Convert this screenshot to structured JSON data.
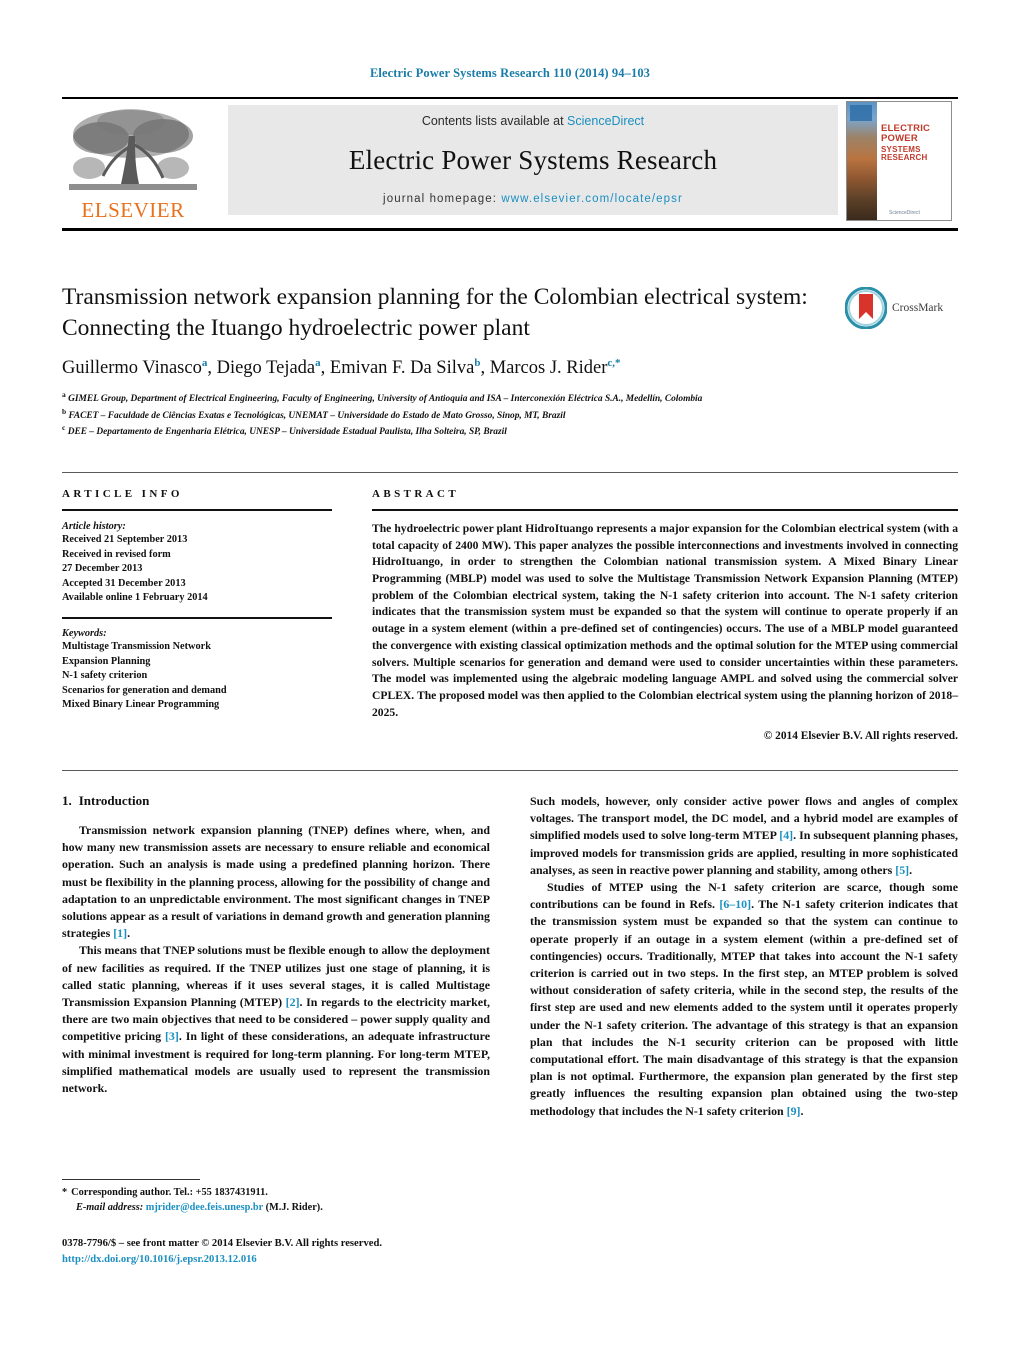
{
  "running_head": "Electric Power Systems Research 110 (2014) 94–103",
  "masthead": {
    "publisher_name": "ELSEVIER",
    "contents_prefix": "Contents lists available at ",
    "contents_link": "ScienceDirect",
    "journal_title": "Electric Power Systems Research",
    "homepage_prefix": "journal homepage: ",
    "homepage_url": "www.elsevier.com/locate/epsr",
    "cover": {
      "line1": "ELECTRIC POWER",
      "line2": "SYSTEMS RESEARCH",
      "foot": "ScienceDirect"
    }
  },
  "article": {
    "title": "Transmission network expansion planning for the Colombian electrical system: Connecting the Ituango hydroelectric power plant",
    "authors_plain": "Guillermo Vinasco a, Diego Tejada a, Emivan F. Da Silva b, Marcos J. Rider c,*",
    "authors": [
      {
        "name": "Guillermo Vinasco",
        "sup": "a"
      },
      {
        "name": "Diego Tejada",
        "sup": "a"
      },
      {
        "name": "Emivan F. Da Silva",
        "sup": "b"
      },
      {
        "name": "Marcos J. Rider",
        "sup": "c,*"
      }
    ],
    "affiliations": [
      {
        "marker": "a",
        "text": "GIMEL Group, Department of Electrical Engineering, Faculty of Engineering, University of Antioquia and ISA – Interconexión Eléctrica S.A., Medellín, Colombia"
      },
      {
        "marker": "b",
        "text": "FACET – Faculdade de Ciências Exatas e Tecnológicas, UNEMAT – Universidade do Estado de Mato Grosso, Sinop, MT, Brazil"
      },
      {
        "marker": "c",
        "text": "DEE – Departamento de Engenharia Elétrica, UNESP – Universidade Estadual Paulista, Ilha Solteira, SP, Brazil"
      }
    ],
    "crossmark_label": "CrossMark"
  },
  "info": {
    "label": "ARTICLE INFO",
    "history_title": "Article history:",
    "history_lines": [
      "Received 21 September 2013",
      "Received in revised form",
      "27 December 2013",
      "Accepted 31 December 2013",
      "Available online 1 February 2014"
    ],
    "keywords_title": "Keywords:",
    "keywords": [
      "Multistage Transmission Network",
      "Expansion Planning",
      "N-1 safety criterion",
      "Scenarios for generation and demand",
      "Mixed Binary Linear Programming"
    ]
  },
  "abstract": {
    "label": "ABSTRACT",
    "text": "The hydroelectric power plant HidroItuango represents a major expansion for the Colombian electrical system (with a total capacity of 2400 MW). This paper analyzes the possible interconnections and investments involved in connecting HidroItuango, in order to strengthen the Colombian national transmission system. A Mixed Binary Linear Programming (MBLP) model was used to solve the Multistage Transmission Network Expansion Planning (MTEP) problem of the Colombian electrical system, taking the N-1 safety criterion into account. The N-1 safety criterion indicates that the transmission system must be expanded so that the system will continue to operate properly if an outage in a system element (within a pre-defined set of contingencies) occurs. The use of a MBLP model guaranteed the convergence with existing classical optimization methods and the optimal solution for the MTEP using commercial solvers. Multiple scenarios for generation and demand were used to consider uncertainties within these parameters. The model was implemented using the algebraic modeling language AMPL and solved using the commercial solver CPLEX. The proposed model was then applied to the Colombian electrical system using the planning horizon of 2018–2025.",
    "copyright": "© 2014 Elsevier B.V. All rights reserved."
  },
  "introduction": {
    "number": "1.",
    "heading": "Introduction",
    "left_paragraphs": [
      "Transmission network expansion planning (TNEP) defines where, when, and how many new transmission assets are necessary to ensure reliable and economical operation. Such an analysis is made using a predefined planning horizon. There must be flexibility in the planning process, allowing for the possibility of change and adaptation to an unpredictable environment. The most significant changes in TNEP solutions appear as a result of variations in demand growth and generation planning strategies [1].",
      "This means that TNEP solutions must be flexible enough to allow the deployment of new facilities as required. If the TNEP utilizes just one stage of planning, it is called static planning, whereas if it uses several stages, it is called Multistage Transmission Expansion Planning (MTEP) [2]. In regards to the electricity market, there are two main objectives that need to be considered – power supply quality and competitive pricing [3]. In light of these considerations, an adequate infrastructure with minimal investment is required for long-term planning. For long-term MTEP, simplified mathematical models are usually used to represent the transmission network."
    ],
    "right_paragraphs": [
      "Such models, however, only consider active power flows and angles of complex voltages. The transport model, the DC model, and a hybrid model are examples of simplified models used to solve long-term MTEP [4]. In subsequent planning phases, improved models for transmission grids are applied, resulting in more sophisticated analyses, as seen in reactive power planning and stability, among others [5].",
      "Studies of MTEP using the N-1 safety criterion are scarce, though some contributions can be found in Refs. [6–10]. The N-1 safety criterion indicates that the transmission system must be expanded so that the system can continue to operate properly if an outage in a system element (within a pre-defined set of contingencies) occurs. Traditionally, MTEP that takes into account the N-1 safety criterion is carried out in two steps. In the first step, an MTEP problem is solved without consideration of safety criteria, while in the second step, the results of the first step are used and new elements added to the system until it operates properly under the N-1 safety criterion. The advantage of this strategy is that an expansion plan that includes the N-1 security criterion can be proposed with little computational effort. The main disadvantage of this strategy is that the expansion plan is not optimal. Furthermore, the expansion plan generated by the first step greatly influences the resulting expansion plan obtained using the two-step methodology that includes the N-1 safety criterion [9]."
    ]
  },
  "footnote": {
    "star": "*",
    "corresponding": "Corresponding author. Tel.: +55 1837431911.",
    "email_label": "E-mail address:",
    "email": "mjrider@dee.feis.unesp.br",
    "email_suffix": "(M.J. Rider)."
  },
  "imprint": {
    "line1": "0378-7796/$ – see front matter © 2014 Elsevier B.V. All rights reserved.",
    "doi": "http://dx.doi.org/10.1016/j.epsr.2013.12.016"
  },
  "colors": {
    "link": "#1a8fc1",
    "running_head": "#1a7ca8",
    "elsevier_orange": "#e9711c",
    "cover_red": "#c0392b"
  }
}
